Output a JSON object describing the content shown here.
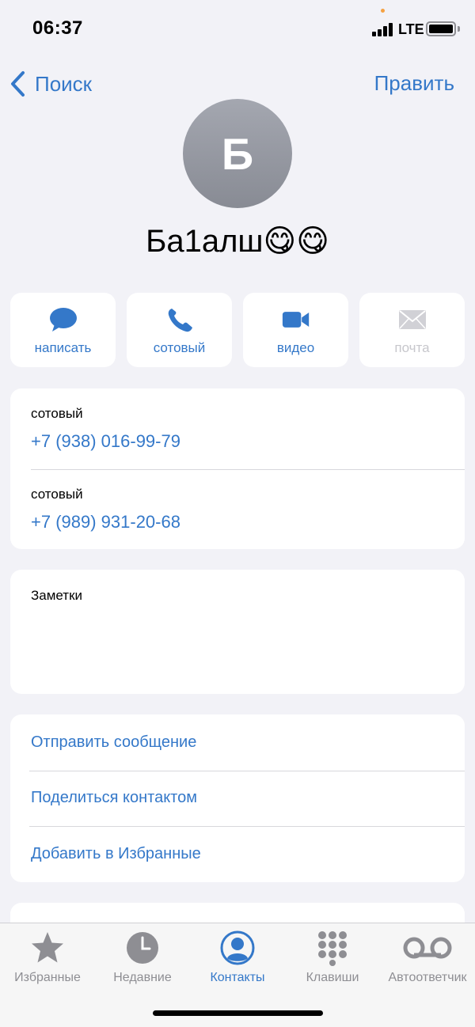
{
  "status_bar": {
    "time": "06:37",
    "network": "LTE"
  },
  "nav": {
    "back_label": "Поиск",
    "edit_label": "Править"
  },
  "contact": {
    "initial": "Б",
    "name": "Ба1алш😋😋"
  },
  "actions": [
    {
      "label": "написать",
      "icon": "message-bubble-icon",
      "enabled": true
    },
    {
      "label": "сотовый",
      "icon": "phone-icon",
      "enabled": true
    },
    {
      "label": "видео",
      "icon": "video-camera-icon",
      "enabled": true
    },
    {
      "label": "почта",
      "icon": "mail-envelope-icon",
      "enabled": false
    }
  ],
  "phones": [
    {
      "type": "сотовый",
      "number": "+7 (938) 016-99-79"
    },
    {
      "type": "сотовый",
      "number": "+7 (989) 931-20-68"
    }
  ],
  "notes": {
    "label": "Заметки",
    "value": ""
  },
  "links": [
    {
      "label": "Отправить сообщение"
    },
    {
      "label": "Поделиться контактом"
    },
    {
      "label": "Добавить в Избранные"
    }
  ],
  "tab_bar": {
    "tabs": [
      {
        "label": "Избранные",
        "icon": "star-icon",
        "active": false
      },
      {
        "label": "Недавние",
        "icon": "clock-icon",
        "active": false
      },
      {
        "label": "Контакты",
        "icon": "person-circle-icon",
        "active": true
      },
      {
        "label": "Клавиши",
        "icon": "keypad-icon",
        "active": false
      },
      {
        "label": "Автоответчик",
        "icon": "voicemail-icon",
        "active": false
      }
    ]
  },
  "colors": {
    "accent": "#3478c9",
    "inactive": "#8e8e93",
    "background": "#f2f2f7",
    "avatar": "#9a9da6"
  }
}
